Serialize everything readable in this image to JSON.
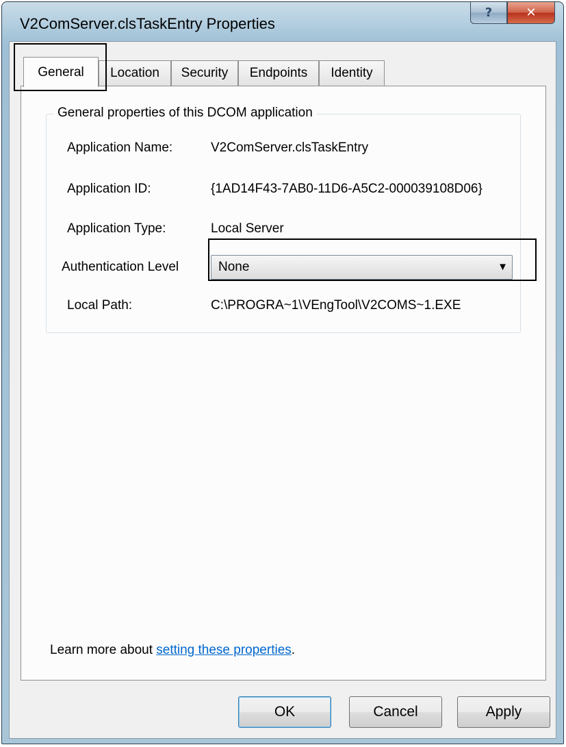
{
  "window": {
    "title": "V2ComServer.clsTaskEntry Properties",
    "help_glyph": "?",
    "close_glyph": "✕"
  },
  "tabs": [
    {
      "label": "General"
    },
    {
      "label": "Location"
    },
    {
      "label": "Security"
    },
    {
      "label": "Endpoints"
    },
    {
      "label": "Identity"
    }
  ],
  "group": {
    "legend": "General properties of this DCOM application"
  },
  "fields": {
    "app_name_label": "Application Name:",
    "app_name_value": "V2ComServer.clsTaskEntry",
    "app_id_label": "Application ID:",
    "app_id_value": "{1AD14F43-7AB0-11D6-A5C2-000039108D06}",
    "app_type_label": "Application Type:",
    "app_type_value": "Local Server",
    "auth_label": "Authentication Level",
    "auth_value": "None",
    "local_path_label": "Local Path:",
    "local_path_value": "C:\\PROGRA~1\\VEngTool\\V2COMS~1.EXE"
  },
  "learn_more": {
    "prefix": "Learn more about ",
    "link": "setting these properties",
    "suffix": "."
  },
  "buttons": {
    "ok": "OK",
    "cancel": "Cancel",
    "apply": "Apply"
  }
}
